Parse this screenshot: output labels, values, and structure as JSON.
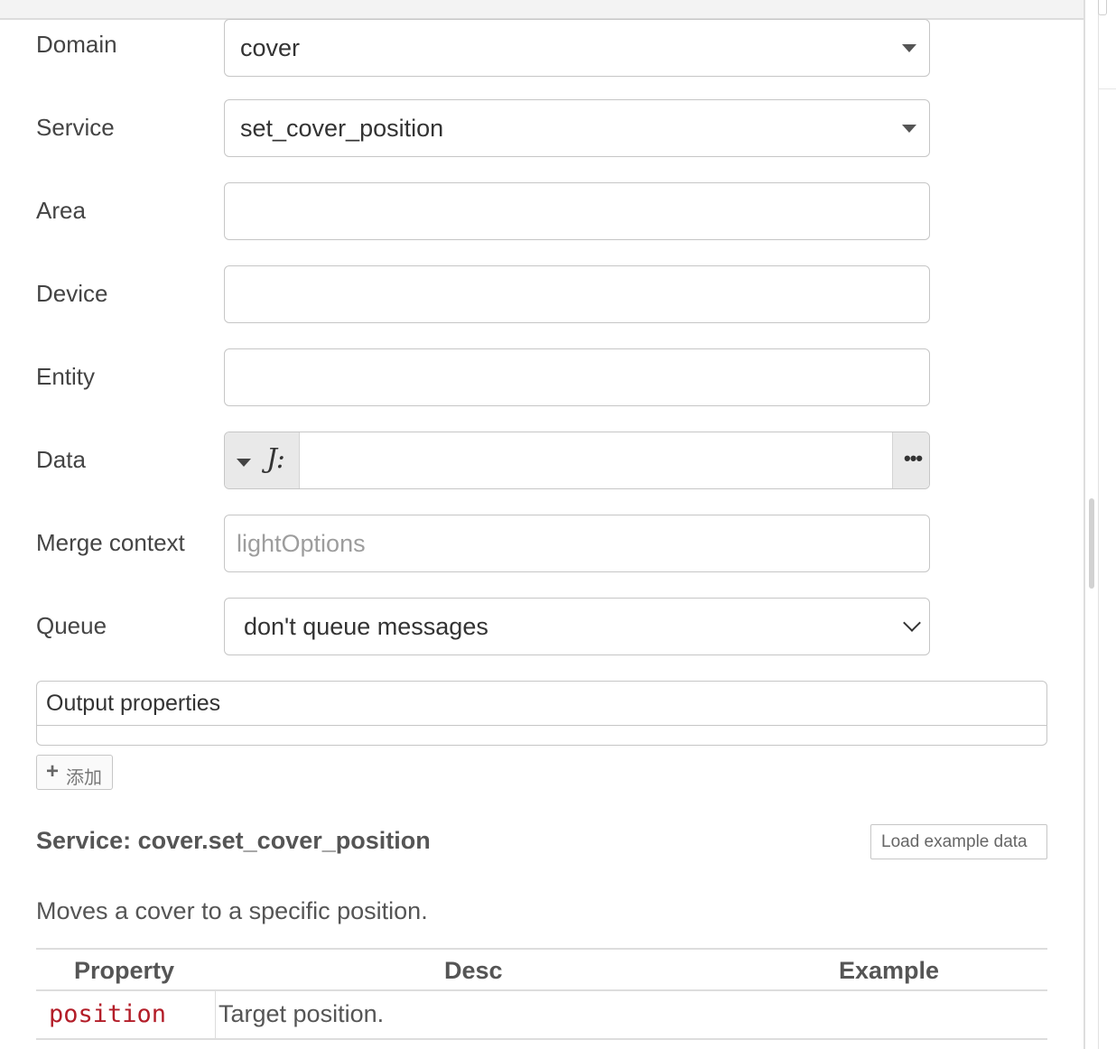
{
  "form": {
    "domain": {
      "label": "Domain",
      "value": "cover"
    },
    "service": {
      "label": "Service",
      "value": "set_cover_position"
    },
    "area": {
      "label": "Area",
      "value": ""
    },
    "device": {
      "label": "Device",
      "value": ""
    },
    "entity": {
      "label": "Entity",
      "value": ""
    },
    "data": {
      "label": "Data",
      "type_icon": "J:",
      "value": "",
      "expand_icon": "•••"
    },
    "merge_context": {
      "label": "Merge context",
      "placeholder": "lightOptions",
      "value": ""
    },
    "queue": {
      "label": "Queue",
      "value": "don't queue messages"
    }
  },
  "output_properties": {
    "header": "Output properties",
    "add_button": "添加",
    "add_icon": "plus-icon"
  },
  "service_info": {
    "title": "Service: cover.set_cover_position",
    "load_button": "Load example data",
    "description": "Moves a cover to a specific position.",
    "table": {
      "headers": [
        "Property",
        "Desc",
        "Example"
      ],
      "rows": [
        {
          "property": "position",
          "desc": "Target position.",
          "example": ""
        }
      ]
    }
  }
}
